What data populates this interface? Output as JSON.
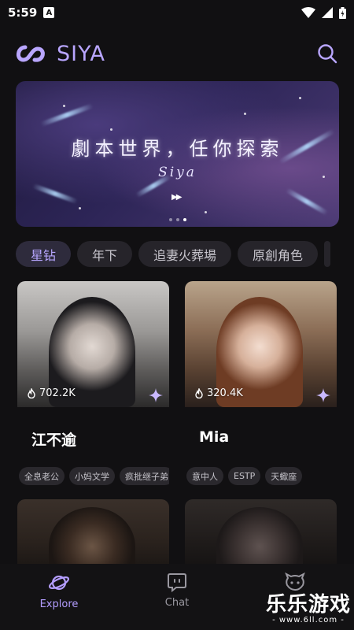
{
  "status_bar": {
    "time": "5:59",
    "badge": "A"
  },
  "app": {
    "name": "SIYA",
    "accent": "#b9a6ff"
  },
  "banner": {
    "title": "劇本世界，任你探索",
    "subtitle": "Siya",
    "page_count": 3,
    "active_index": 2
  },
  "tags": [
    {
      "label": "星钻",
      "active": true
    },
    {
      "label": "年下",
      "active": false
    },
    {
      "label": "追妻火葬場",
      "active": false
    },
    {
      "label": "原創角色",
      "active": false
    }
  ],
  "cards": [
    {
      "likes": "702.2K",
      "name": "江不逾",
      "tags": [
        "全息老公",
        "小妈文学",
        "疯批继子弟"
      ]
    },
    {
      "likes": "320.4K",
      "name": "Mia",
      "tags": [
        "意中人",
        "ESTP",
        "天蠍座"
      ]
    }
  ],
  "nav": {
    "explore": "Explore",
    "chat": "Chat"
  },
  "watermark": {
    "main": "乐乐游戏",
    "sub": "- www.6ll.com -"
  }
}
